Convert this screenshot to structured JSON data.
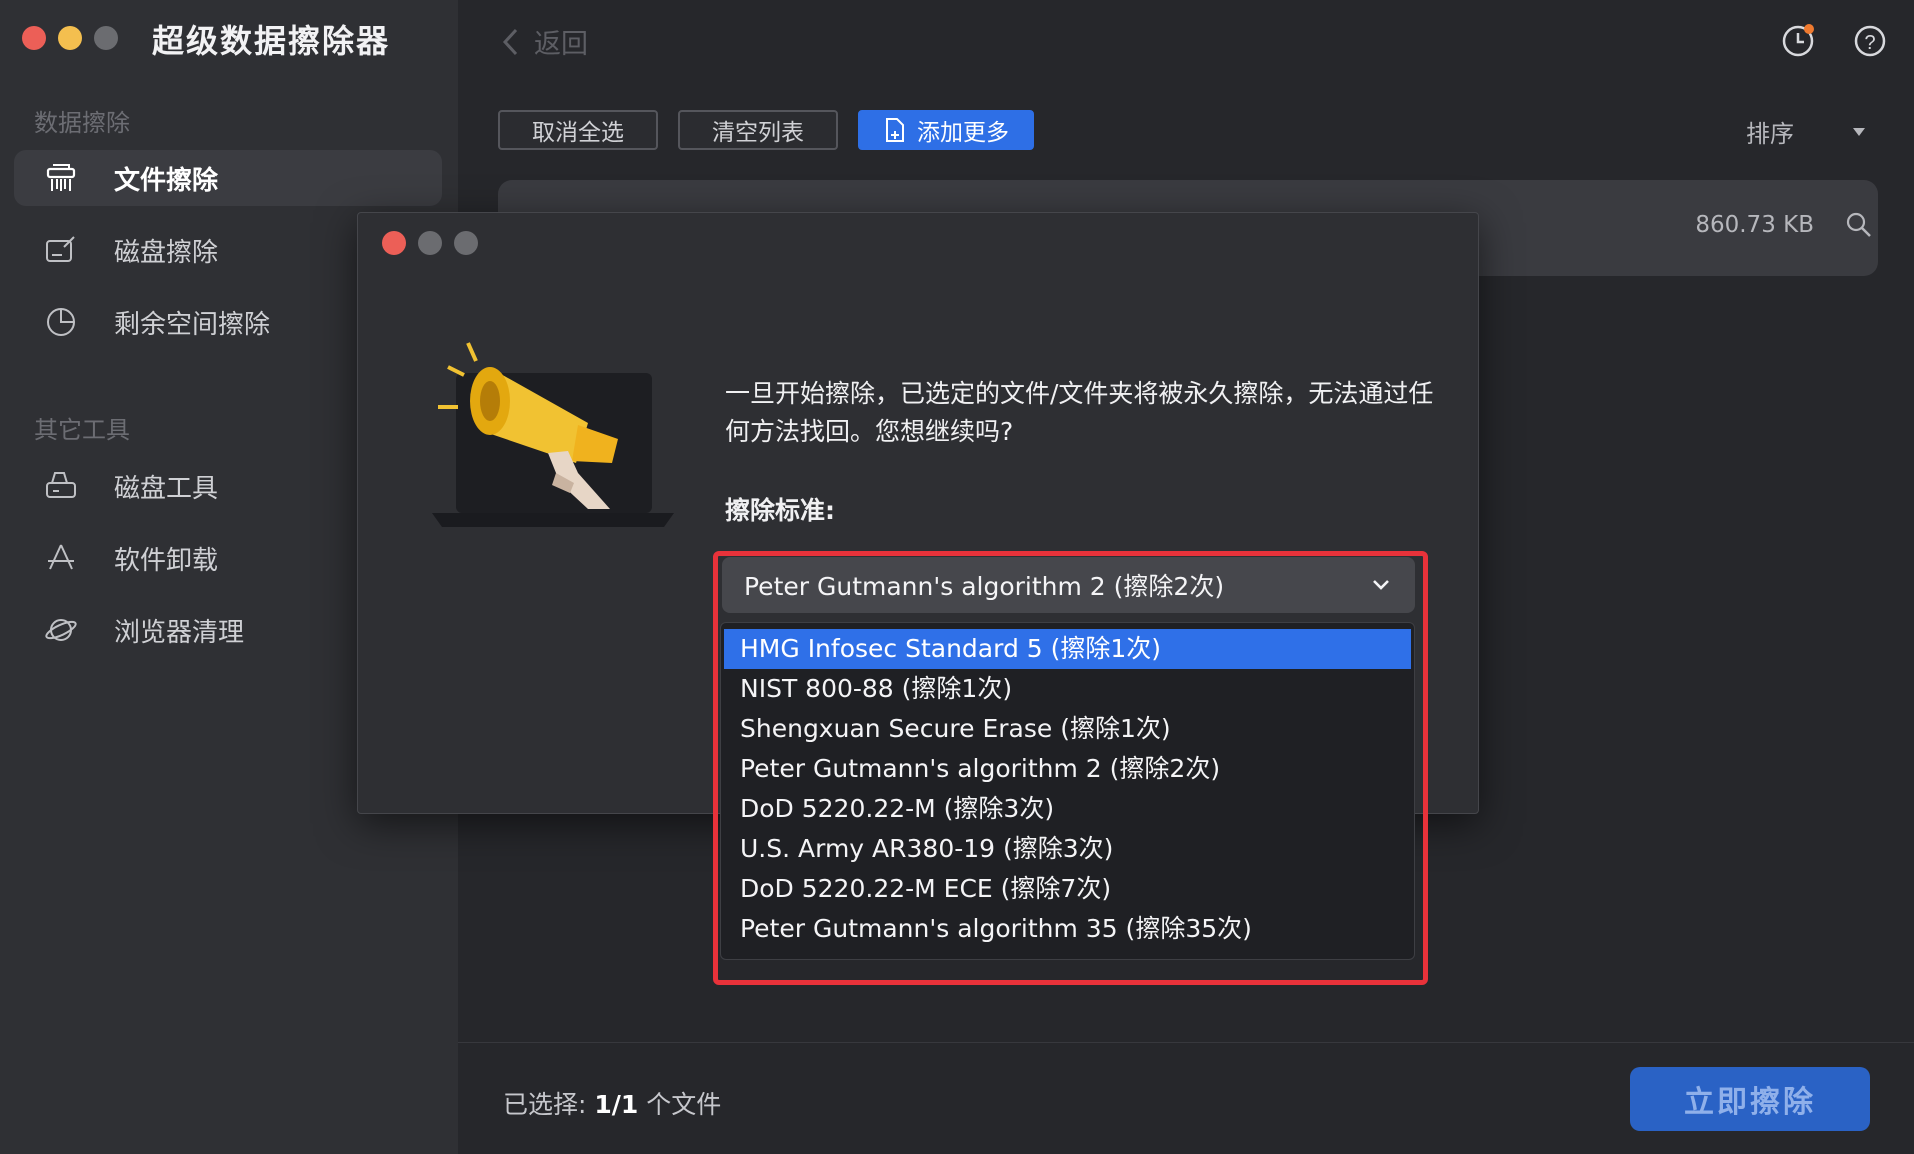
{
  "window": {
    "title": "超级数据擦除器",
    "back_label": "返回"
  },
  "sidebar": {
    "section1": "数据擦除",
    "items1": [
      {
        "label": "文件擦除",
        "icon": "shredder-icon"
      },
      {
        "label": "磁盘擦除",
        "icon": "disk-edit-icon"
      },
      {
        "label": "剩余空间擦除",
        "icon": "pie-chart-icon"
      }
    ],
    "section2": "其它工具",
    "items2": [
      {
        "label": "磁盘工具",
        "icon": "disk-tool-icon"
      },
      {
        "label": "软件卸载",
        "icon": "app-store-icon"
      },
      {
        "label": "浏览器清理",
        "icon": "planet-icon"
      }
    ]
  },
  "toolbar": {
    "deselect_all": "取消全选",
    "clear_list": "清空列表",
    "add_more": "添加更多",
    "sort": "排序"
  },
  "file": {
    "size": "860.73 KB"
  },
  "dialog": {
    "warning": "一旦开始擦除，已选定的文件/文件夹将被永久擦除，无法通过任何方法找回。您想继续吗?",
    "standard_label": "擦除标准:",
    "selected_value": "Peter Gutmann's algorithm 2 (擦除2次)",
    "options": [
      "HMG Infosec Standard 5 (擦除1次)",
      "NIST 800-88 (擦除1次)",
      "Shengxuan Secure Erase (擦除1次)",
      "Peter Gutmann's algorithm 2 (擦除2次)",
      "DoD 5220.22-M (擦除3次)",
      "U.S. Army AR380-19 (擦除3次)",
      "DoD 5220.22-M ECE (擦除7次)",
      "Peter Gutmann's algorithm 35 (擦除35次)"
    ],
    "highlighted_index": 0
  },
  "footer": {
    "selected_prefix": "已选择: ",
    "selected_count": "1/1",
    "selected_suffix": " 个文件",
    "erase_button": "立即擦除"
  },
  "colors": {
    "accent": "#2f70e8",
    "highlight_border": "#e8323a",
    "close": "#ec5f57",
    "minimize": "#f4bf4f"
  }
}
